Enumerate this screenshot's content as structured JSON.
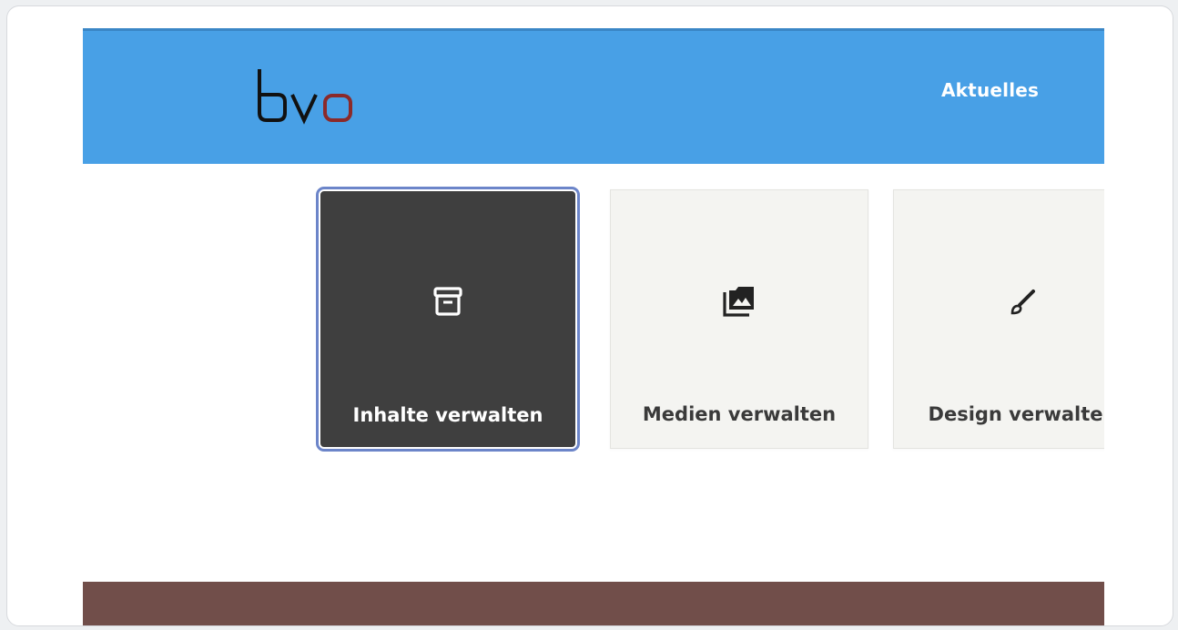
{
  "header": {
    "logo_text": "bvo",
    "nav": {
      "aktuelles": "Aktuelles"
    },
    "background_color": "#48a0e6"
  },
  "tiles": [
    {
      "label": "Inhalte verwalten",
      "icon": "archive-box-icon",
      "selected": true
    },
    {
      "label": "Medien verwalten",
      "icon": "photo-library-icon",
      "selected": false
    },
    {
      "label": "Design verwalten",
      "icon": "paintbrush-icon",
      "selected": false
    }
  ],
  "colors": {
    "selected_tile": "#3f3f3f",
    "tile": "#f4f4f1",
    "footer": "#714e4a",
    "logo_accent": "#8b2a2a"
  }
}
